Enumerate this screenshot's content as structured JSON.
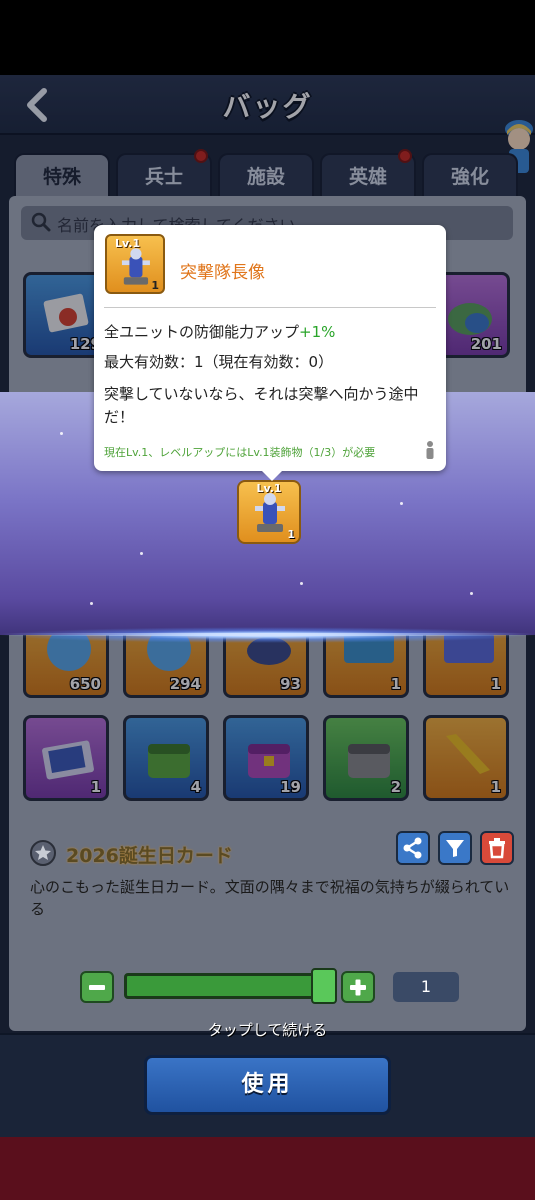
{
  "header": {
    "title": "バッグ",
    "back_icon": "chevron-left-icon"
  },
  "tabs": [
    {
      "label": "特殊",
      "active": true,
      "badge": false
    },
    {
      "label": "兵士",
      "active": false,
      "badge": true
    },
    {
      "label": "施設",
      "active": false,
      "badge": false
    },
    {
      "label": "英雄",
      "active": false,
      "badge": true
    },
    {
      "label": "強化",
      "active": false,
      "badge": false
    }
  ],
  "search": {
    "placeholder": "名前を入力して検索してください"
  },
  "items_row1": [
    {
      "count": "129",
      "color": "#3a8ad0"
    },
    {
      "count": "201",
      "color": "#a24ac8"
    }
  ],
  "items_row2": [
    {
      "count": "650",
      "color": "#e89a2a"
    },
    {
      "count": "294",
      "color": "#e89a2a"
    },
    {
      "count": "93",
      "color": "#e89a2a"
    },
    {
      "count": "1",
      "color": "#e89a2a"
    },
    {
      "count": "1",
      "color": "#e89a2a"
    }
  ],
  "items_row3": [
    {
      "count": "1",
      "color": "#a24ac8"
    },
    {
      "count": "4",
      "color": "#3a8ad0"
    },
    {
      "count": "19",
      "color": "#3a8ad0"
    },
    {
      "count": "2",
      "color": "#3aa44a"
    },
    {
      "count": "1",
      "color": "#e89a2a"
    }
  ],
  "reward": {
    "level": "Lv.1",
    "count": "1"
  },
  "tooltip": {
    "level": "Lv.1",
    "count": "1",
    "name": "突撃隊長像",
    "effect_text": "全ユニットの防御能力アップ",
    "effect_value": "+1%",
    "limit": "最大有効数：1（現在有効数：0）",
    "description": "突撃していないなら、それは突撃へ向かう途中だ！",
    "footer": "現在Lv.1、レベルアップにはLv.1装飾物（1/3）が必要"
  },
  "detail": {
    "name": "2026誕生日カード",
    "description": "心のこもった誕生日カード。文面の隅々まで祝福の気持ちが綴られている",
    "actions": [
      "share-icon",
      "filter-icon",
      "trash-icon"
    ]
  },
  "quantity": {
    "value": "1",
    "fill_fraction": 1.0
  },
  "tap_to_continue": "タップして続ける",
  "use_button": "使用",
  "colors": {
    "accent_orange": "#e0751a",
    "effect_green": "#2aa52a",
    "use_blue": "#2a62b4",
    "badge_red": "#c8281e"
  }
}
